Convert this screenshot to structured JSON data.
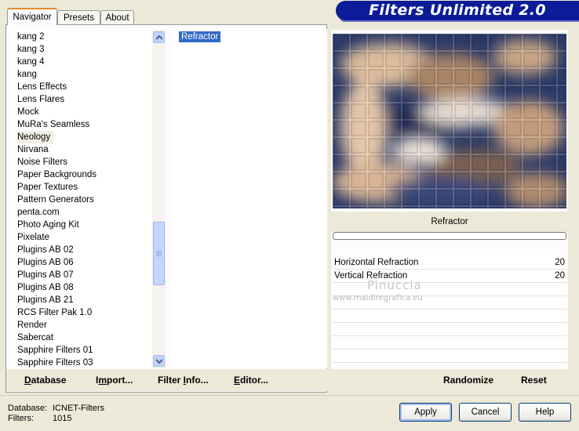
{
  "app": {
    "banner_title": "Filters Unlimited 2.0"
  },
  "tabs": [
    {
      "label": "Navigator",
      "active": true
    },
    {
      "label": "Presets",
      "active": false
    },
    {
      "label": "About",
      "active": false
    }
  ],
  "categories": [
    "kang 2",
    "kang 3",
    "kang 4",
    "kang",
    "Lens Effects",
    "Lens Flares",
    "Mock",
    "MuRa's Seamless",
    "Neology",
    "Nirvana",
    "Noise Filters",
    "Paper Backgrounds",
    "Paper Textures",
    "Pattern Generators",
    "penta.com",
    "Photo Aging Kit",
    "Pixelate",
    "Plugins AB 02",
    "Plugins AB 06",
    "Plugins AB 07",
    "Plugins AB 08",
    "Plugins AB 21",
    "RCS Filter Pak 1.0",
    "Render",
    "Sabercat",
    "Sapphire Filters 01",
    "Sapphire Filters 03"
  ],
  "selected_category": "Neology",
  "filters": [
    "Refractor"
  ],
  "left_buttons": {
    "database": {
      "label_u": "D",
      "label_rest": "atabase"
    },
    "import": {
      "label_pre": "I",
      "label_u": "m",
      "label_rest": "port..."
    },
    "filter_info": {
      "label_pre": "Filter ",
      "label_u": "I",
      "label_rest": "nfo..."
    },
    "editor": {
      "label_u": "E",
      "label_rest": "ditor..."
    }
  },
  "preview": {
    "filter_name": "Refractor",
    "progress": 0
  },
  "parameters": [
    {
      "name": "Horizontal Refraction",
      "value": "20"
    },
    {
      "name": "Vertical Refraction",
      "value": "20"
    }
  ],
  "right_buttons": {
    "randomize": "Randomize",
    "reset": "Reset"
  },
  "watermark": {
    "line1": "Pinuccia",
    "line2": "www.maidiregrafica.eu"
  },
  "status": {
    "database_label": "Database:",
    "database_value": "ICNET-Filters",
    "filters_label": "Filters:",
    "filters_value": "1015"
  },
  "dialog_buttons": {
    "apply": "Apply",
    "cancel": "Cancel",
    "help": "Help"
  },
  "colors": {
    "banner": "#0c1c98",
    "selection": "#316ac5",
    "tab_accent": "#e68b2c"
  }
}
